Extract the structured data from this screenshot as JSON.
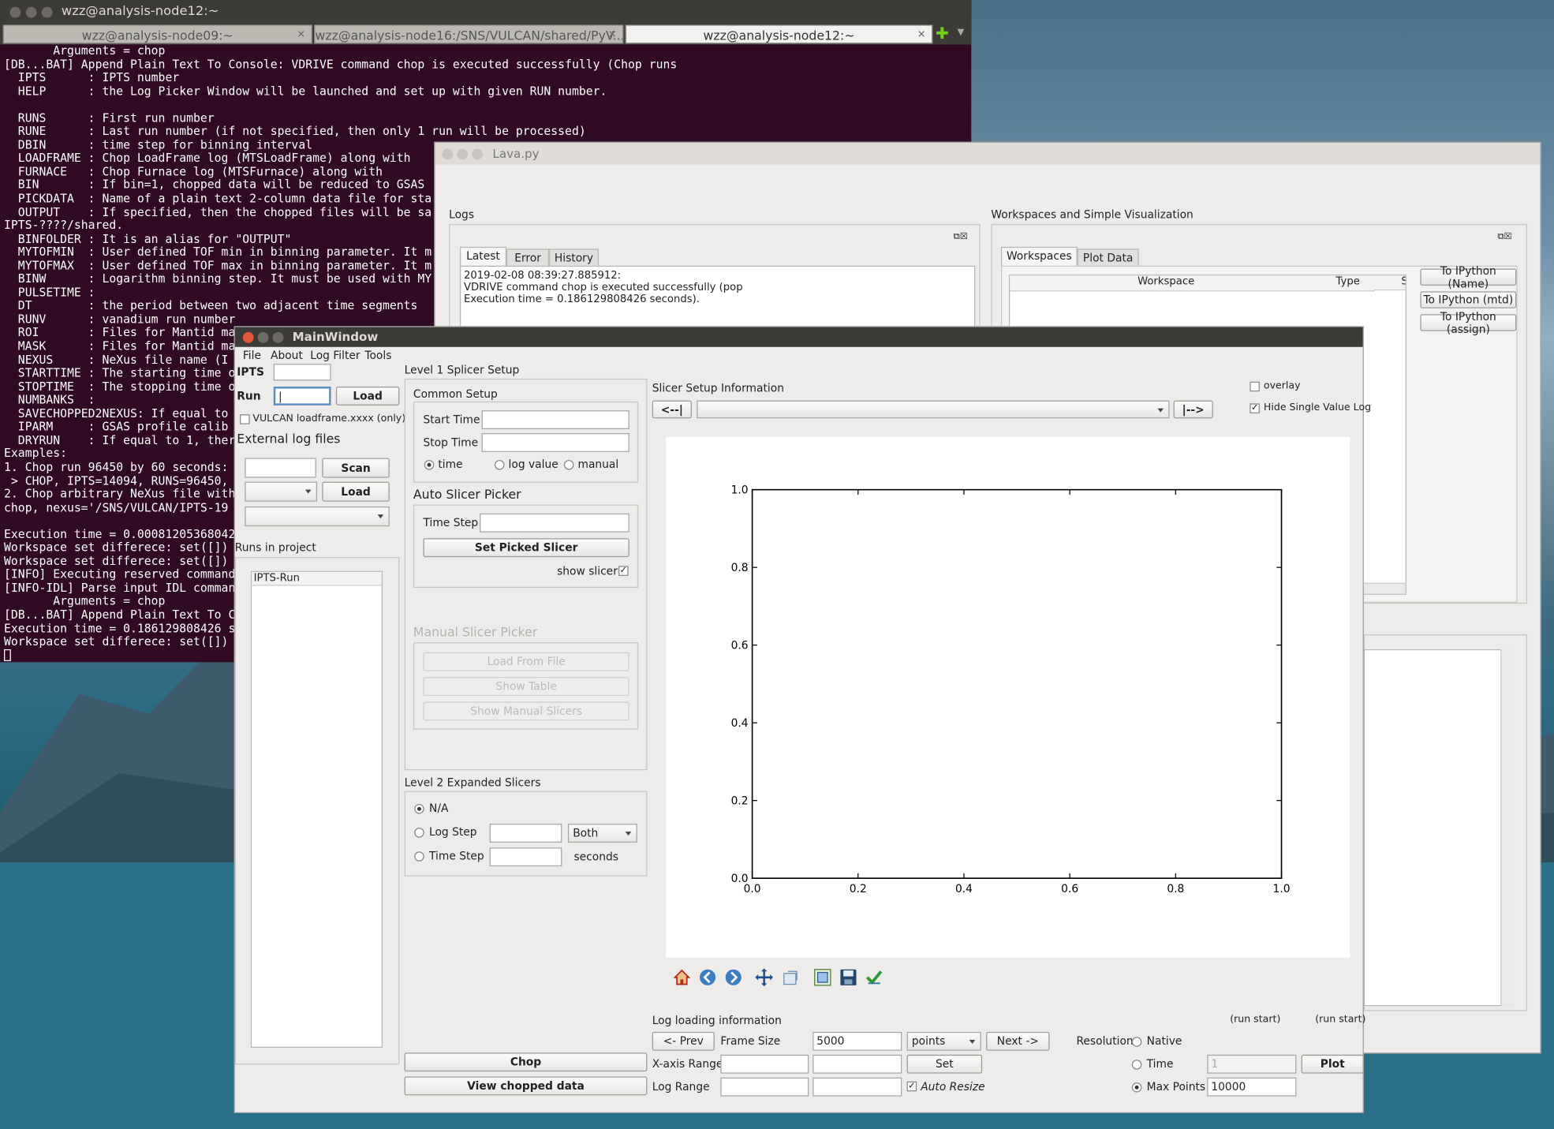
{
  "terminal": {
    "title": "wzz@analysis-node12:~",
    "tabs": [
      {
        "label": "wzz@analysis-node09:~"
      },
      {
        "label": "wzz@analysis-node16:/SNS/VULCAN/shared/PyV..."
      },
      {
        "label": "wzz@analysis-node12:~"
      }
    ],
    "text": "       Arguments = chop\n[DB...BAT] Append Plain Text To Console: VDRIVE command chop is executed successfully (Chop runs\n  IPTS      : IPTS number\n  HELP      : the Log Picker Window will be launched and set up with given RUN number.\n\n  RUNS      : First run number\n  RUNE      : Last run number (if not specified, then only 1 run will be processed)\n  DBIN      : time step for binning interval\n  LOADFRAME : Chop LoadFrame log (MTSLoadFrame) along with\n  FURNACE   : Chop Furnace log (MTSFurnace) along with\n  BIN       : If bin=1, chopped data will be reduced to GSAS\n  PICKDATA  : Name of a plain text 2-column data file for sta\n  OUTPUT    : If specified, then the chopped files will be sa\nIPTS-????/shared.\n  BINFOLDER : It is an alias for \"OUTPUT\"\n  MYTOFMIN  : User defined TOF min in binning parameter. It m\n  MYTOFMAX  : User defined TOF max in binning parameter. It m\n  BINW      : Logarithm binning step. It must be used with MY\n  PULSETIME :\n  DT        : the period between two adjacent time segments\n  RUNV      : vanadium run number\n  ROI       : Files for Mantid ma\n  MASK      : Files for Mantid ma\n  NEXUS     : NeXus file name (I\n  STARTTIME : The starting time o\n  STOPTIME  : The stopping time o\n  NUMBANKS  :\n  SAVECHOPPED2NEXUS: If equal to\n  IPARM     : GSAS profile calib\n  DRYRUN    : If equal to 1, ther\nExamples:\n1. Chop run 96450 by 60 seconds:\n > CHOP, IPTS=14094, RUNS=96450,\n2. Chop arbitrary NeXus file with\nchop, nexus='/SNS/VULCAN/IPTS-19\n\nExecution time = 0.00081205368042\nWorkspace set differece: set([])\nWorkspace set differece: set([])\n[INFO] Executing reserved command\n[INFO-IDL] Parse input IDL comman\n       Arguments = chop\n[DB...BAT] Append Plain Text To C\nExecution time = 0.186129808426 s\nWorkspace set differece: set([])"
  },
  "lava": {
    "title": "Lava.py",
    "logs_label": "Logs",
    "log_tabs": [
      "Latest",
      "Error",
      "History"
    ],
    "log_text": "2019-02-08 08:39:27.885912:\nVDRIVE command chop is executed successfully (pop\nExecution time = 0.186129808426 seconds).",
    "ws_label": "Workspaces and Simple Visualization",
    "ws_tabs": [
      "Workspaces",
      "Plot Data"
    ],
    "ws_columns": [
      "Workspace",
      "Type",
      "S"
    ],
    "ipy_buttons": [
      "To IPython (Name)",
      "To IPython (mtd)",
      "To IPython (assign)"
    ]
  },
  "main": {
    "title": "MainWindow",
    "menu": [
      "File",
      "About",
      "Log Filter",
      "Tools"
    ],
    "ipts_label": "IPTS",
    "run_label": "Run",
    "load_label": "Load",
    "vulcan_label": "VULCAN loadframe.xxxx (only)",
    "ext_label": "External log files",
    "scan_label": "Scan",
    "load2_label": "Load",
    "runs_label": "Runs in project",
    "runs_column": "IPTS-Run",
    "level1_label": "Level 1 Splicer Setup",
    "common_label": "Common Setup",
    "start_time": "Start Time",
    "stop_time": "Stop Time",
    "radio_time": "time",
    "radio_log": "log value",
    "radio_manual": "manual",
    "auto_label": "Auto Slicer Picker",
    "time_step": "Time Step",
    "set_picked": "Set Picked Slicer",
    "show_slicer": "show slicer",
    "manual_label": "Manual Slicer Picker",
    "load_file": "Load From File",
    "show_table": "Show Table",
    "show_manual": "Show Manual Slicers",
    "level2_label": "Level 2 Expanded Slicers",
    "na": "N/A",
    "log_step": "Log Step",
    "both": "Both",
    "time_step2": "Time Step",
    "seconds": "seconds",
    "chop": "Chop",
    "view_chopped": "View chopped data",
    "slicer_info": "Slicer Setup Information",
    "prev_btn": "<--|",
    "next_btn": "|-->",
    "overlay": "overlay",
    "hide_single": "Hide Single Value Log",
    "log_loading": "Log loading information",
    "run_start1": "(run start)",
    "run_start2": "(run start)",
    "prev": "<- Prev",
    "frame_size": "Frame Size",
    "frame_value": "5000",
    "points": "points",
    "next": "Next ->",
    "resolution": "Resolution",
    "native": "Native",
    "xrange": "X-axis Range",
    "set": "Set",
    "time": "Time",
    "time_value": "1",
    "plot": "Plot",
    "log_range": "Log Range",
    "auto_resize": "Auto Resize",
    "max_points": "Max Points",
    "max_value": "10000"
  },
  "chart_data": {
    "type": "line",
    "series": [],
    "xlim": [
      0.0,
      1.0
    ],
    "ylim": [
      0.0,
      1.0
    ],
    "x_ticks": [
      "0.0",
      "0.2",
      "0.4",
      "0.6",
      "0.8",
      "1.0"
    ],
    "y_ticks": [
      "0.0",
      "0.2",
      "0.4",
      "0.6",
      "0.8",
      "1.0"
    ],
    "title": "",
    "xlabel": "",
    "ylabel": ""
  },
  "toolbar_icons": [
    "home-icon",
    "back-icon",
    "forward-icon",
    "pan-icon",
    "zoom-icon",
    "subplots-icon",
    "save-icon",
    "check-icon"
  ]
}
